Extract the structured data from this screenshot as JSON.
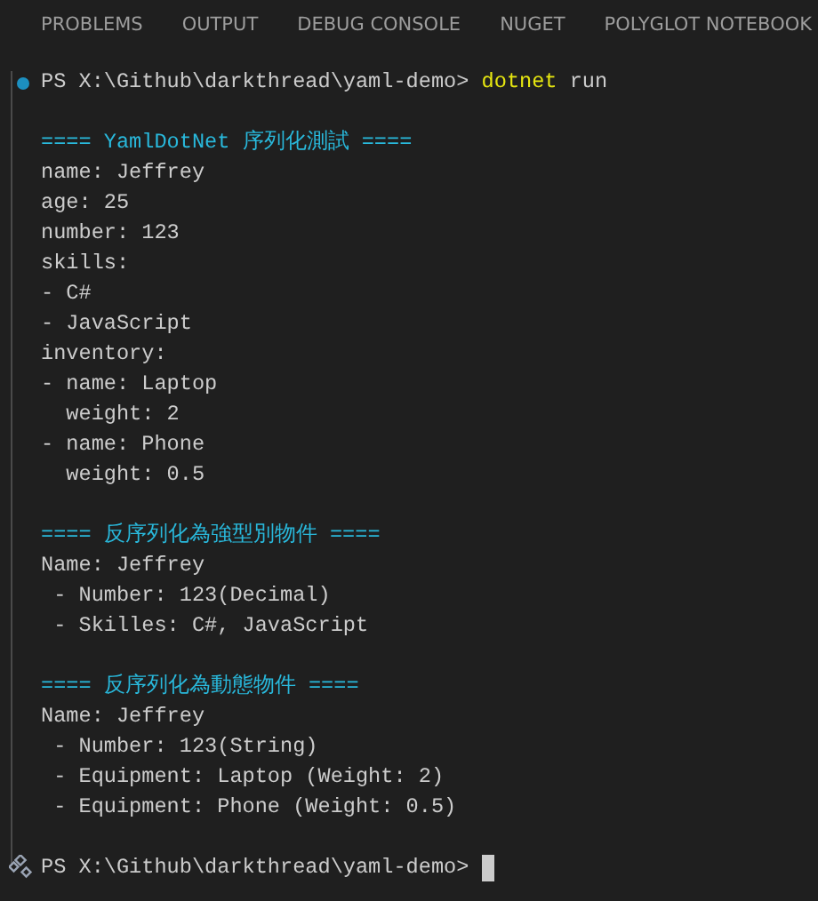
{
  "tabs": [
    {
      "label": "PROBLEMS"
    },
    {
      "label": "OUTPUT"
    },
    {
      "label": "DEBUG CONSOLE"
    },
    {
      "label": "NUGET"
    },
    {
      "label": "POLYGLOT NOTEBOOK"
    }
  ],
  "terminal": {
    "command_prompt": {
      "prompt": "PS X:\\Github\\darkthread\\yaml-demo>",
      "command": "dotnet",
      "args": "run"
    },
    "sections": [
      {
        "heading": "==== YamlDotNet 序列化測試 ====",
        "lines": [
          "name: Jeffrey",
          "age: 25",
          "number: 123",
          "skills:",
          "- C#",
          "- JavaScript",
          "inventory:",
          "- name: Laptop",
          "  weight: 2",
          "- name: Phone",
          "  weight: 0.5"
        ]
      },
      {
        "heading": "==== 反序列化為強型別物件 ====",
        "lines": [
          "Name: Jeffrey",
          " - Number: 123(Decimal)",
          " - Skilles: C#, JavaScript"
        ]
      },
      {
        "heading": "==== 反序列化為動態物件 ====",
        "lines": [
          "Name: Jeffrey",
          " - Number: 123(String)",
          " - Equipment: Laptop (Weight: 2)",
          " - Equipment: Phone (Weight: 0.5)"
        ]
      }
    ],
    "final_prompt": "PS X:\\Github\\darkthread\\yaml-demo>"
  }
}
